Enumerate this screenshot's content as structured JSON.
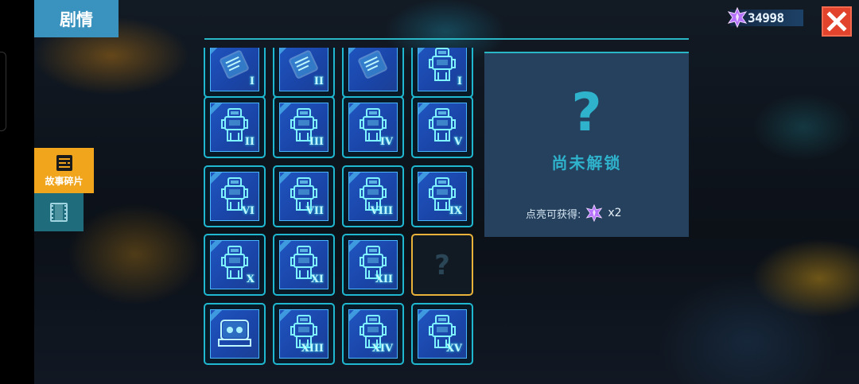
{
  "header": {
    "title": "剧情"
  },
  "currency": {
    "amount": "34998",
    "icon": "purple-star-gem-icon"
  },
  "close": {
    "icon": "close-x-icon",
    "color": "#e1432c"
  },
  "side_tabs": [
    {
      "label": "故事碎片",
      "icon": "story-fragments-icon",
      "active": true
    },
    {
      "label": "",
      "icon": "film-icon",
      "active": false
    }
  ],
  "grid": {
    "rows": [
      [
        {
          "roman": "I",
          "type": "tablet"
        },
        {
          "roman": "II",
          "type": "tablet"
        },
        {
          "roman": "",
          "type": "tablet"
        },
        {
          "roman": "I",
          "type": "robot"
        }
      ],
      [
        {
          "roman": "II",
          "type": "robot"
        },
        {
          "roman": "III",
          "type": "robot"
        },
        {
          "roman": "IV",
          "type": "robot"
        },
        {
          "roman": "V",
          "type": "robot"
        }
      ],
      [
        {
          "roman": "VI",
          "type": "robot"
        },
        {
          "roman": "VII",
          "type": "robot"
        },
        {
          "roman": "VIII",
          "type": "robot"
        },
        {
          "roman": "IX",
          "type": "robot"
        }
      ],
      [
        {
          "roman": "X",
          "type": "robot"
        },
        {
          "roman": "XI",
          "type": "robot"
        },
        {
          "roman": "XII",
          "type": "robot"
        },
        {
          "roman": "",
          "type": "locked",
          "symbol": "?"
        }
      ],
      [
        {
          "roman": "",
          "type": "machine"
        },
        {
          "roman": "XIII",
          "type": "robot"
        },
        {
          "roman": "XIV",
          "type": "robot"
        },
        {
          "roman": "XV",
          "type": "robot"
        }
      ]
    ]
  },
  "detail": {
    "symbol": "?",
    "status": "尚未解锁",
    "reward_label": "点亮可获得:",
    "reward_icon": "purple-star-gem-icon",
    "reward_count": "x2"
  },
  "colors": {
    "accent_cyan": "#2ab7c5",
    "tab_active": "#f0a51c",
    "title_tab": "#3a93be",
    "locked_border": "#e9b23a"
  }
}
